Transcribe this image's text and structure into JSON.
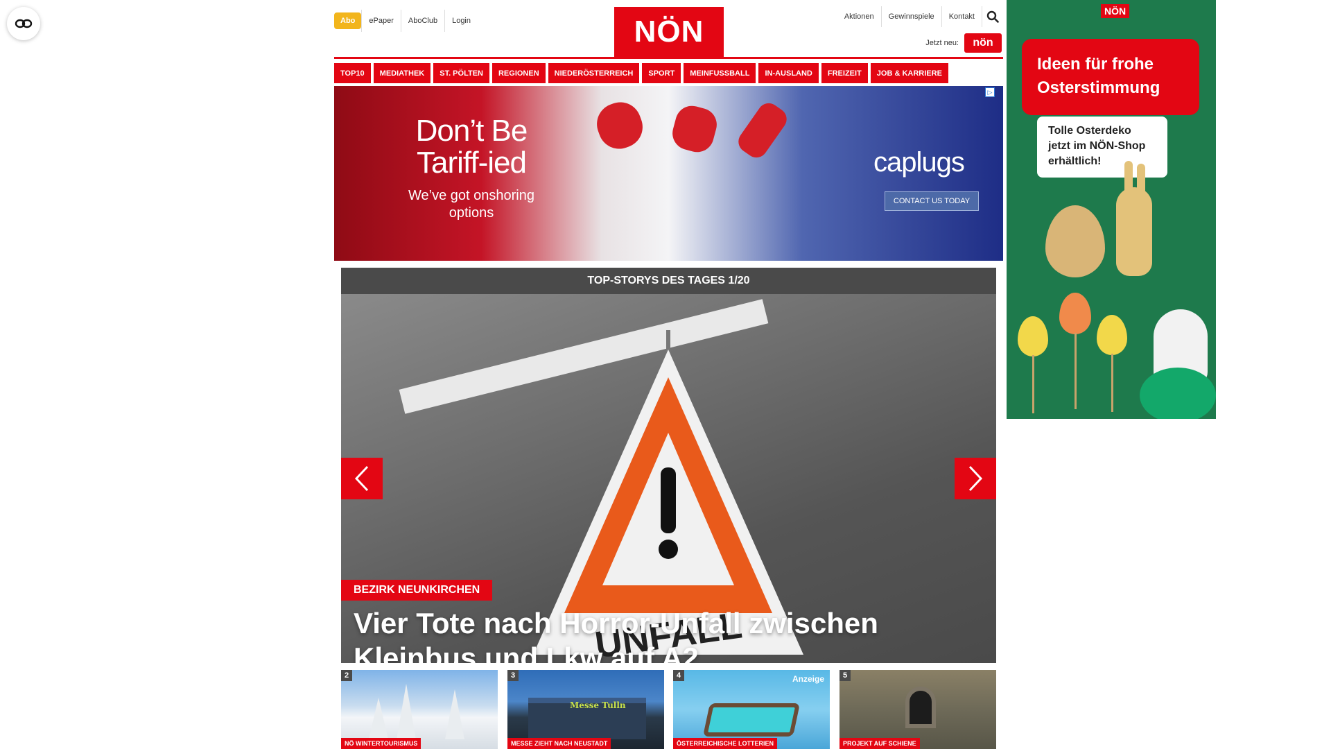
{
  "colors": {
    "brand_red": "#e30613",
    "abo_yellow": "#f2b51c",
    "slider_header_gray": "#4a4a4a"
  },
  "accessibility": {
    "icon": "eye-accessibility-icon"
  },
  "header": {
    "abo_label": "Abo",
    "left_links": [
      "ePaper",
      "AboClub",
      "Login"
    ],
    "logo_text": "NÖN",
    "right_links": [
      "Aktionen",
      "Gewinnspiele",
      "Kontakt"
    ],
    "search_icon": "search-icon",
    "jetzt_neu_label": "Jetzt neu:",
    "jetzt_badge_text": "nön"
  },
  "section_nav": [
    "TOP10",
    "MEDIATHEK",
    "ST. PÖLTEN",
    "REGIONEN",
    "NIEDERÖSTERREICH",
    "SPORT",
    "MEINFUSSBALL",
    "IN-AUSLAND",
    "FREIZEIT",
    "JOB & KARRIERE"
  ],
  "banner_ad": {
    "headline": "Don’t Be Tariff-ied",
    "subline": "We’ve got onshoring options",
    "brand": "caplugs",
    "cta": "CONTACT US TODAY"
  },
  "top_stories": {
    "header": "TOP-STORYS DES TAGES 1/20",
    "sign_text": "UNFALL",
    "tag": "BEZIRK NEUNKIRCHEN",
    "title": "Vier Tote nach Horror-Unfall zwischen Kleinbus und Lkw auf A2",
    "prev_icon": "chevron-left-icon",
    "next_icon": "chevron-right-icon"
  },
  "thumbnails": [
    {
      "num": "2",
      "tag": "NÖ WINTERTOURISMUS",
      "anzeige": ""
    },
    {
      "num": "3",
      "tag": "MESSE ZIEHT NACH NEUSTADT",
      "anzeige": "",
      "sign": "Messe Tulln"
    },
    {
      "num": "4",
      "tag": "ÖSTERREICHISCHE LOTTERIEN",
      "anzeige": "Anzeige"
    },
    {
      "num": "5",
      "tag": "PROJEKT AUF SCHIENE",
      "anzeige": ""
    }
  ],
  "sky_ad": {
    "brand": "NÖN",
    "headline": "Ideen für frohe Osterstimmung",
    "card": "Tolle Osterdeko jetzt im NÖN-Shop erhältlich!"
  }
}
